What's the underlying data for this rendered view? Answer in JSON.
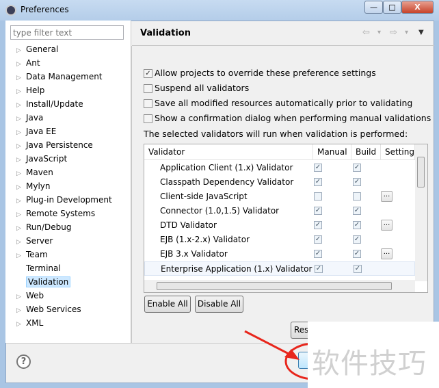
{
  "window": {
    "title": "Preferences",
    "minimize": "—",
    "maximize": "□",
    "close": "X"
  },
  "sidebar": {
    "filter_placeholder": "type filter text",
    "items": [
      {
        "label": "General",
        "expandable": true
      },
      {
        "label": "Ant",
        "expandable": true
      },
      {
        "label": "Data Management",
        "expandable": true
      },
      {
        "label": "Help",
        "expandable": true
      },
      {
        "label": "Install/Update",
        "expandable": true
      },
      {
        "label": "Java",
        "expandable": true
      },
      {
        "label": "Java EE",
        "expandable": true
      },
      {
        "label": "Java Persistence",
        "expandable": true
      },
      {
        "label": "JavaScript",
        "expandable": true
      },
      {
        "label": "Maven",
        "expandable": true
      },
      {
        "label": "Mylyn",
        "expandable": true
      },
      {
        "label": "Plug-in Development",
        "expandable": true
      },
      {
        "label": "Remote Systems",
        "expandable": true
      },
      {
        "label": "Run/Debug",
        "expandable": true
      },
      {
        "label": "Server",
        "expandable": true
      },
      {
        "label": "Team",
        "expandable": true
      },
      {
        "label": "Terminal",
        "expandable": false
      },
      {
        "label": "Validation",
        "expandable": false,
        "selected": true
      },
      {
        "label": "Web",
        "expandable": true
      },
      {
        "label": "Web Services",
        "expandable": true
      },
      {
        "label": "XML",
        "expandable": true
      }
    ]
  },
  "page": {
    "title": "Validation",
    "nav": {
      "back": "⇦",
      "forward": "⇨",
      "menu": "▼",
      "dropdown": "▾"
    },
    "options": [
      {
        "label": "Allow projects to override these preference settings",
        "checked": true
      },
      {
        "label": "Suspend all validators",
        "checked": false
      },
      {
        "label": "Save all modified resources automatically prior to validating",
        "checked": false
      },
      {
        "label": "Show a confirmation dialog when performing manual validations",
        "checked": false
      }
    ],
    "info": "The selected validators will run when validation is performed:",
    "table": {
      "columns": [
        "Validator",
        "Manual",
        "Build",
        "Setting"
      ],
      "rows": [
        {
          "name": "Application Client (1.x) Validator",
          "manual": true,
          "build": true,
          "settings": false
        },
        {
          "name": "Classpath Dependency Validator",
          "manual": true,
          "build": true,
          "settings": false
        },
        {
          "name": "Client-side JavaScript",
          "manual": false,
          "build": false,
          "settings": true
        },
        {
          "name": "Connector (1.0,1.5) Validator",
          "manual": true,
          "build": true,
          "settings": false
        },
        {
          "name": "DTD Validator",
          "manual": true,
          "build": true,
          "settings": true
        },
        {
          "name": "EJB (1.x-2.x) Validator",
          "manual": true,
          "build": true,
          "settings": false
        },
        {
          "name": "EJB 3.x Validator",
          "manual": true,
          "build": true,
          "settings": true
        },
        {
          "name": "Enterprise Application (1.x) Validator",
          "manual": true,
          "build": true,
          "settings": false
        }
      ],
      "settings_label": "...",
      "check": "✓"
    },
    "enable_all": "Enable All",
    "disable_all": "Disable All",
    "restore_defaults": "Res",
    "apply": ""
  },
  "footer": {
    "help": "?"
  },
  "watermark": "软件技巧",
  "colors": {
    "annotation": "#e8261c",
    "selection": "#cde8ff"
  }
}
